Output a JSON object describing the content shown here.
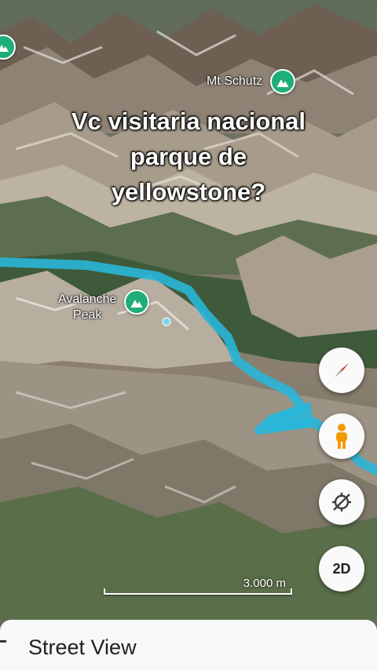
{
  "overlay": {
    "caption_lines": [
      "Vc visitaria nacional",
      "parque de",
      "yellowstone?"
    ]
  },
  "map": {
    "pois": [
      {
        "name": "Mt Schutz"
      },
      {
        "name_line1": "Avalanche",
        "name_line2": "Peak"
      }
    ],
    "river_color": "#29b6d8",
    "pin_color": "#1eae77",
    "scale_label": "3.000 m"
  },
  "controls": {
    "compass": "compass-icon",
    "street_view": "pegman-icon",
    "tilt": "tilt-toggle-icon",
    "view_mode_label": "2D"
  },
  "sheet": {
    "title": "Street View"
  }
}
